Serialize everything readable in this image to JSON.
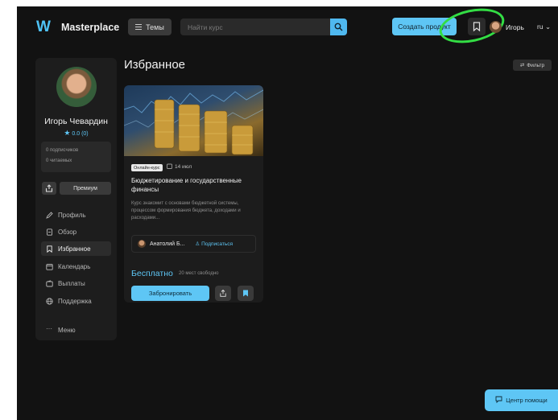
{
  "header": {
    "logo_mark": "W",
    "logo_text": "Masterplace",
    "themes_label": "Темы",
    "search_placeholder": "Найти курс",
    "create_label": "Создать продукт",
    "user_name": "Игорь",
    "language": "ru"
  },
  "sidebar": {
    "profile_name": "Игорь Чевардин",
    "rating": "0.0 (0)",
    "subscribers": "0 подписчиков",
    "readers": "0 читаемых",
    "premium_label": "Премиум",
    "items": [
      {
        "label": "Профиль",
        "icon": "pencil-icon"
      },
      {
        "label": "Обзор",
        "icon": "document-icon"
      },
      {
        "label": "Избранное",
        "icon": "bookmark-icon",
        "active": true
      },
      {
        "label": "Календарь",
        "icon": "calendar-icon"
      },
      {
        "label": "Выплаты",
        "icon": "wallet-icon"
      },
      {
        "label": "Поддержка",
        "icon": "globe-icon"
      },
      {
        "label": "Меню",
        "icon": "dots-icon"
      }
    ]
  },
  "main": {
    "title": "Избранное",
    "filter_label": "Фильтр",
    "card": {
      "badge": "Онлайн-курс",
      "date": "14 июл",
      "title": "Бюджетирование и государственные финансы",
      "description": "Курс знакомит с основами бюджетной системы, процессом формирования бюджета, доходами и расходами...",
      "author": "Анатолий Б...",
      "subscribe_label": "Подписаться",
      "price": "Бесплатно",
      "seats": "20 мест свободно",
      "book_label": "Забронировать"
    }
  },
  "help": {
    "label": "Центр помощи"
  },
  "colors": {
    "accent": "#5ec6f5",
    "background": "#121212",
    "panel": "#1d1d1d",
    "highlight_ring": "#33dd44"
  }
}
